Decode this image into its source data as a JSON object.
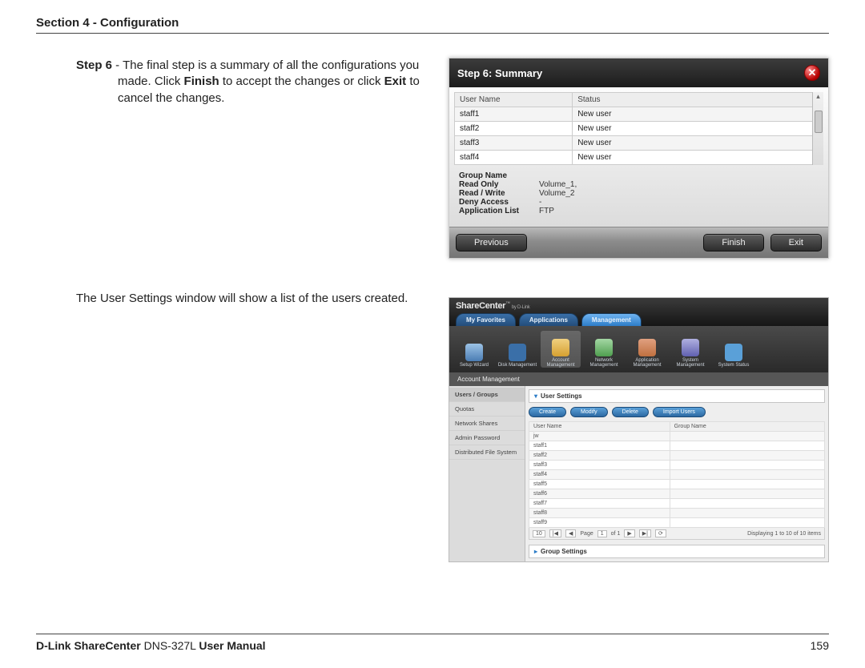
{
  "header": {
    "section": "Section 4 - Configuration"
  },
  "step6": {
    "label": "Step 6",
    "dash": " - ",
    "text1": "The final step is a summary of all the configurations you made. Click ",
    "bold1": "Finish",
    "text2": " to accept the changes or click ",
    "bold2": "Exit",
    "text3": " to cancel the changes."
  },
  "dialog": {
    "title": "Step 6: Summary",
    "close_glyph": "✕",
    "col_user": "User Name",
    "col_status": "Status",
    "rows": [
      {
        "u": "staff1",
        "s": "New user"
      },
      {
        "u": "staff2",
        "s": "New user"
      },
      {
        "u": "staff3",
        "s": "New user"
      },
      {
        "u": "staff4",
        "s": "New user"
      }
    ],
    "props": {
      "group_name_k": "Group Name",
      "group_name_v": "",
      "read_only_k": "Read Only",
      "read_only_v": "Volume_1,",
      "read_write_k": "Read / Write",
      "read_write_v": "Volume_2",
      "deny_k": "Deny Access",
      "deny_v": "-",
      "app_k": "Application List",
      "app_v": "FTP"
    },
    "btn_prev": "Previous",
    "btn_finish": "Finish",
    "btn_exit": "Exit"
  },
  "para2": "The User Settings window will show a list of the users created.",
  "app": {
    "brand": "ShareCenter",
    "brand_sub": "by D-Link",
    "tm": "™",
    "tabs": {
      "fav": "My Favorites",
      "apps": "Applications",
      "mgmt": "Management"
    },
    "ribbon": {
      "r1": "Setup Wizard",
      "r2": "Disk Management",
      "r3": "Account Management",
      "r4": "Network Management",
      "r5": "Application Management",
      "r6": "System Management",
      "r7": "System Status"
    },
    "crumb": "Account Management",
    "sidebar": {
      "s1": "Users / Groups",
      "s2": "Quotas",
      "s3": "Network Shares",
      "s4": "Admin Password",
      "s5": "Distributed File System"
    },
    "panel1": "User Settings",
    "buttons": {
      "b1": "Create",
      "b2": "Modify",
      "b3": "Delete",
      "b4": "Import Users"
    },
    "grid_h1": "User Name",
    "grid_h2": "Group Name",
    "grid_rows": [
      "jw",
      "staff1",
      "staff2",
      "staff3",
      "staff4",
      "staff5",
      "staff6",
      "staff7",
      "staff8",
      "staff9"
    ],
    "pager": {
      "sel10": "10",
      "first": "|◀",
      "prev": "◀",
      "page_lbl": "Page",
      "page_val": "1",
      "of": "of 1",
      "next": "▶",
      "last": "▶|",
      "refresh": "⟳",
      "info": "Displaying 1 to 10 of 10 items"
    },
    "panel2": "Group Settings"
  },
  "footer": {
    "left1": "D-Link ShareCenter",
    "left2": " DNS-327L ",
    "left3": "User Manual",
    "page": "159"
  }
}
